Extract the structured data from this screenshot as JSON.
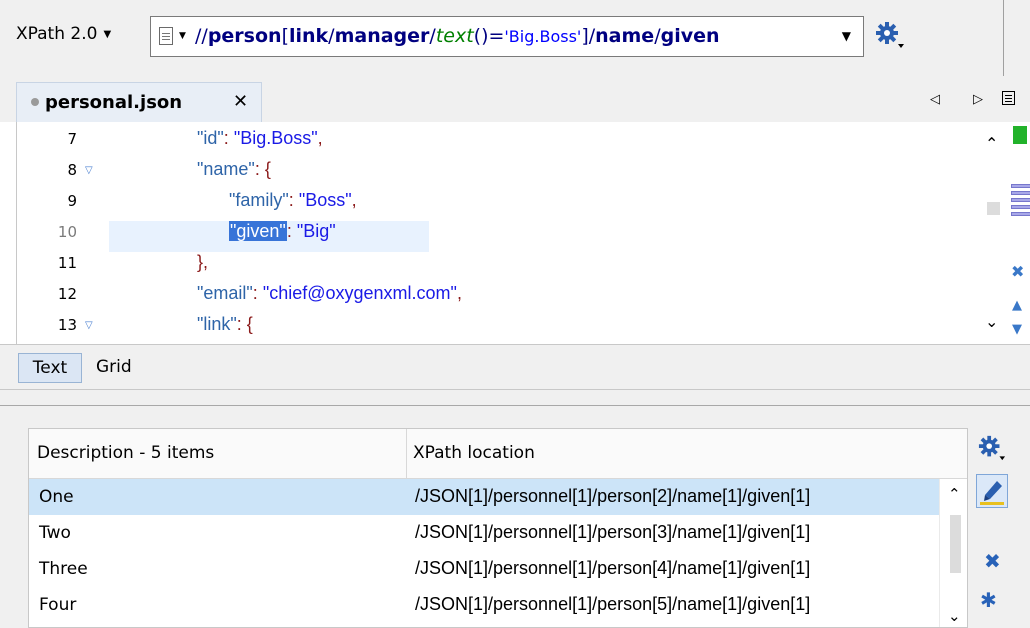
{
  "toolbar": {
    "xpath_version": "XPath 2.0",
    "expression": {
      "slash1": "//",
      "person": "person",
      "lbr": "[",
      "link": "link",
      "slash2": "/",
      "manager": "manager",
      "slash3": "/",
      "text_fn": "text",
      "parens_eq": "()=",
      "string": "'Big.Boss'",
      "rbr": "]",
      "slash4": "/",
      "name": "name",
      "slash5": "/",
      "given": "given"
    }
  },
  "tabs": [
    {
      "label": "personal.json",
      "close": "✕",
      "active": true
    }
  ],
  "editor": {
    "lines": [
      {
        "number": "7",
        "fold": ""
      },
      {
        "number": "8",
        "fold": "▽"
      },
      {
        "number": "9",
        "fold": ""
      },
      {
        "number": "10",
        "fold": ""
      },
      {
        "number": "11",
        "fold": ""
      },
      {
        "number": "12",
        "fold": ""
      },
      {
        "number": "13",
        "fold": "▽"
      }
    ],
    "code": {
      "l7_key": "\"id\"",
      "l7_colon": ": ",
      "l7_val": "\"Big.Boss\"",
      "l7_comma": ",",
      "l8_key": "\"name\"",
      "l8_rest": ": {",
      "l9_key": "\"family\"",
      "l9_colon": ": ",
      "l9_val": "\"Boss\"",
      "l9_comma": ",",
      "l10_key": "\"given\"",
      "l10_colon": ": ",
      "l10_val": "\"Big\"",
      "l11": "},",
      "l12_key": "\"email\"",
      "l12_colon": ": ",
      "l12_val": "\"chief@oxygenxml.com\"",
      "l12_comma": ",",
      "l13_key": "\"link\"",
      "l13_rest": ": {"
    }
  },
  "modes": {
    "text": "Text",
    "grid": "Grid"
  },
  "results": {
    "col_description": "Description - 5 items",
    "col_xpath": "XPath location",
    "rows": [
      {
        "description": "One",
        "xpath": "/JSON[1]/personnel[1]/person[2]/name[1]/given[1]",
        "selected": true
      },
      {
        "description": "Two",
        "xpath": "/JSON[1]/personnel[1]/person[3]/name[1]/given[1]",
        "selected": false
      },
      {
        "description": "Three",
        "xpath": "/JSON[1]/personnel[1]/person[4]/name[1]/given[1]",
        "selected": false
      },
      {
        "description": "Four",
        "xpath": "/JSON[1]/personnel[1]/person[5]/name[1]/given[1]",
        "selected": false
      }
    ]
  },
  "icons": {
    "gear": "gear-icon",
    "document": "document-icon",
    "highlight": "highlighter-icon",
    "remove": "remove-icon",
    "remove_all": "remove-all-icon"
  },
  "colors": {
    "accent": "#3874d8",
    "selected_row": "#cce4f8",
    "json_key": "#2e64a8",
    "json_string": "#1a1ae6",
    "status_ok": "#22b22a"
  }
}
